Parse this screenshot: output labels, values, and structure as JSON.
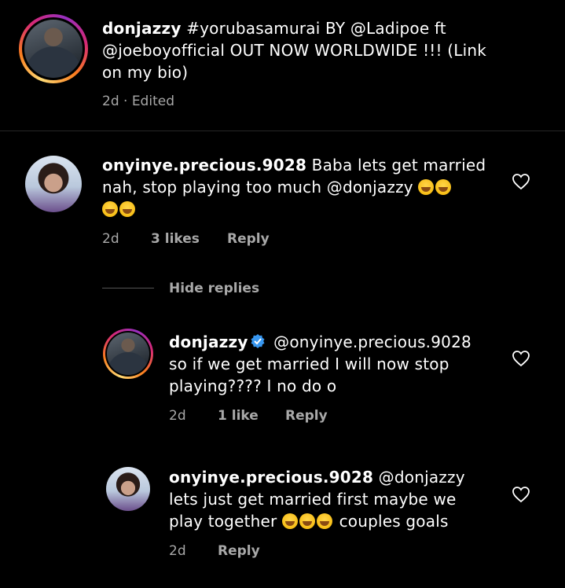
{
  "post": {
    "username": "donjazzy",
    "caption": "#yorubasamurai BY @Ladipoe ft @joeboyofficial OUT NOW WORLDWIDE !!! (Link on my bio)",
    "caption_line1": "#yorubasamurai BY @Ladipoe ft",
    "caption_line2": "@joeboyofficial OUT NOW WORLDWIDE !!! (Link",
    "caption_line3": "on my bio)",
    "meta": "2d · Edited"
  },
  "comment1": {
    "username": "onyinye.precious.9028",
    "line1_text": "Baba lets get married",
    "line2_text": "nah, stop playing too  much @donjazzy",
    "emoji_line1": [
      "rofl-emoji",
      "rofl-emoji"
    ],
    "emoji_line2": [
      "joy-emoji",
      "joy-emoji"
    ],
    "time": "2d",
    "likes": "3 likes",
    "reply": "Reply"
  },
  "replies_toggle": "Hide replies",
  "reply1": {
    "username": "donjazzy",
    "mention": "@onyinye.precious.9028",
    "line2": "so if we get married I will now stop",
    "line3": "playing???? I no do o",
    "time": "2d",
    "likes": "1 like",
    "reply": "Reply"
  },
  "reply2": {
    "username": "onyinye.precious.9028",
    "mention": "@donjazzy",
    "line2": "lets just get married first maybe we",
    "line3_text": "play together",
    "line3_suffix": "couples goals",
    "emojis": [
      "joy-emoji",
      "joy-emoji",
      "joy-emoji"
    ],
    "time": "2d",
    "reply": "Reply"
  },
  "colors": {
    "background": "#000000",
    "text": "#ffffff",
    "meta": "#a8a8a8",
    "verified": "#3897f0",
    "divider": "#262626"
  }
}
